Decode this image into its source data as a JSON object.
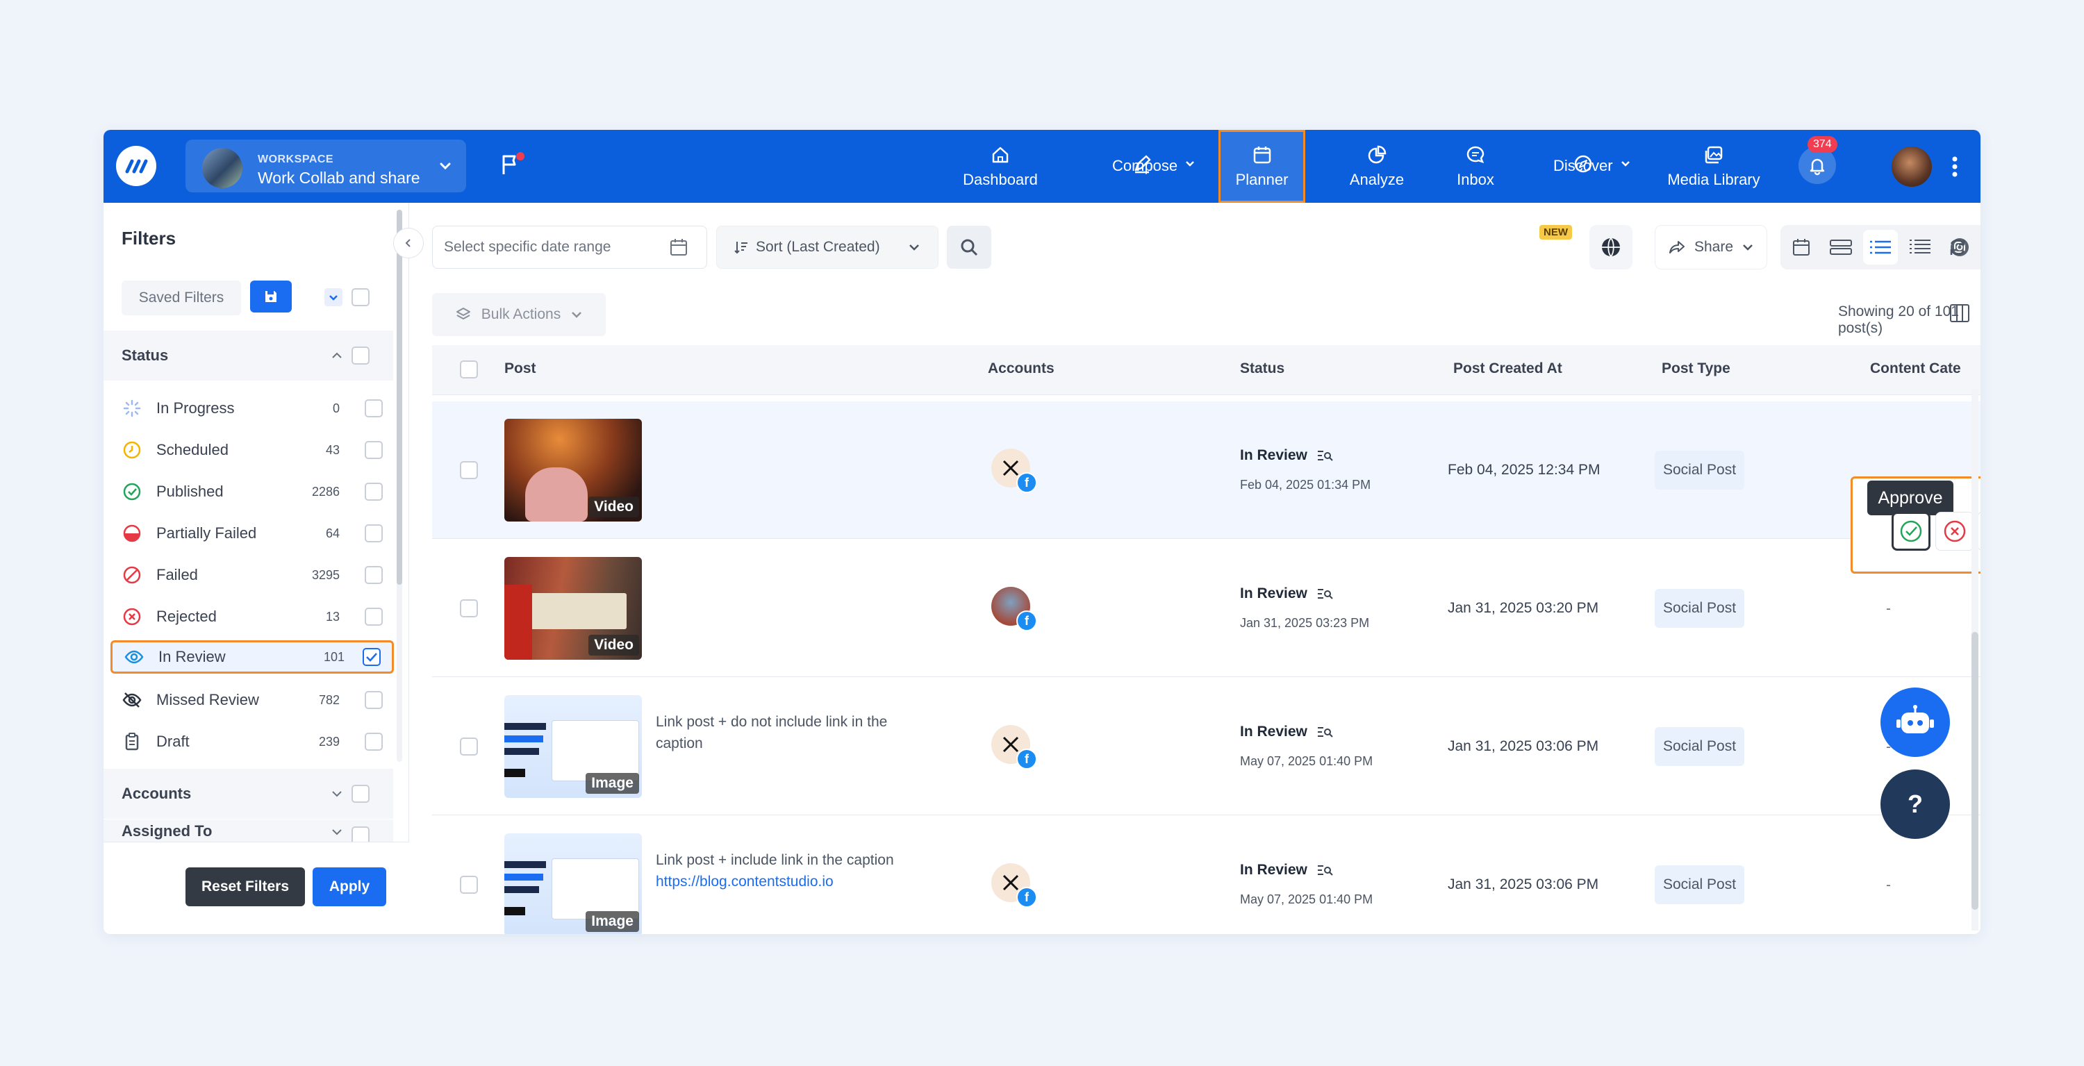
{
  "workspace": {
    "label": "WORKSPACE",
    "name": "Work Collab and share"
  },
  "nav": [
    {
      "label": "Dashboard"
    },
    {
      "label": "Compose"
    },
    {
      "label": "Planner"
    },
    {
      "label": "Analyze"
    },
    {
      "label": "Inbox"
    },
    {
      "label": "Discover"
    },
    {
      "label": "Media Library"
    }
  ],
  "notifications": {
    "count": "374"
  },
  "sidebar": {
    "title": "Filters",
    "saved_filters": "Saved Filters",
    "status_section": "Status",
    "statuses": [
      {
        "label": "In Progress",
        "count": "0"
      },
      {
        "label": "Scheduled",
        "count": "43"
      },
      {
        "label": "Published",
        "count": "2286"
      },
      {
        "label": "Partially Failed",
        "count": "64"
      },
      {
        "label": "Failed",
        "count": "3295"
      },
      {
        "label": "Rejected",
        "count": "13"
      },
      {
        "label": "In Review",
        "count": "101"
      },
      {
        "label": "Missed Review",
        "count": "782"
      },
      {
        "label": "Draft",
        "count": "239"
      }
    ],
    "accounts_section": "Accounts",
    "assigned_section": "Assigned To",
    "reset_label": "Reset Filters",
    "apply_label": "Apply"
  },
  "toolbar": {
    "date_placeholder": "Select specific date range",
    "sort_label": "Sort (Last Created)",
    "new_badge": "NEW",
    "share_label": "Share",
    "bulk_actions": "Bulk Actions",
    "showing": "Showing 20 of 101 post(s)"
  },
  "table": {
    "headers": [
      "Post",
      "Accounts",
      "Status",
      "Post Created At",
      "Post Type",
      "Content Cate"
    ],
    "rows": [
      {
        "thumb_tag": "Video",
        "caption": "",
        "link": "",
        "status": "In Review",
        "status_date": "Feb 04, 2025 01:34 PM",
        "created": "Feb 04, 2025 12:34 PM",
        "type": "Social Post",
        "category": ""
      },
      {
        "thumb_tag": "Video",
        "caption": "",
        "link": "",
        "status": "In Review",
        "status_date": "Jan 31, 2025 03:23 PM",
        "created": "Jan 31, 2025 03:20 PM",
        "type": "Social Post",
        "category": "-"
      },
      {
        "thumb_tag": "Image",
        "caption": "Link post + do not include link in the caption",
        "link": "",
        "status": "In Review",
        "status_date": "May 07, 2025 01:40 PM",
        "created": "Jan 31, 2025 03:06 PM",
        "type": "Social Post",
        "category": "-"
      },
      {
        "thumb_tag": "Image",
        "caption": "Link post + include link in the caption",
        "link": "https://blog.contentstudio.io",
        "status": "In Review",
        "status_date": "May 07, 2025 01:40 PM",
        "created": "Jan 31, 2025 03:06 PM",
        "type": "Social Post",
        "category": "-"
      }
    ]
  },
  "row_actions": {
    "tooltip": "Approve"
  },
  "help": {
    "label": "?"
  }
}
